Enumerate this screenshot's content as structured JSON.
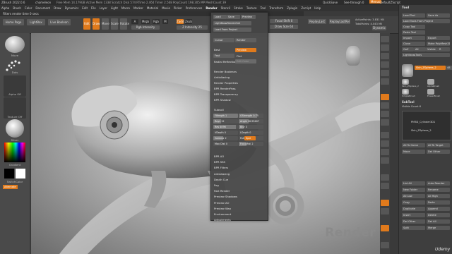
{
  "titlebar": {
    "app": "ZBrush 2022.0.6",
    "file": "chameleon",
    "stats": "Free Mem 14.179GB  Active Mem 1338  Scratch Disk 574  RTime 2.464  Timer 2.568  PolyCount 198.305 MP  MeshCount 39",
    "right": [
      "QuickSave",
      "See-through 0",
      "Menus",
      "DefaultZScript"
    ]
  },
  "menubar": [
    "Alpha",
    "Brush",
    "Color",
    "Document",
    "Draw",
    "Dynamics",
    "Edit",
    "File",
    "Layer",
    "Light",
    "Macro",
    "Marker",
    "Material",
    "Movie",
    "Picker",
    "Preferences",
    "Render",
    "Stencil",
    "Stroke",
    "Texture",
    "Tool",
    "Transform",
    "Zplugin",
    "Zscript",
    "Help"
  ],
  "notice": "Filters render time 0 secs",
  "toolbar": {
    "home": "Home Page",
    "lightbox": "LightBox",
    "livebool": "Live Boolean",
    "edit": "Edit",
    "draw": "Draw",
    "move": "Move",
    "scale": "Scale",
    "rotate": "Rotate",
    "a": "A",
    "mrgb": "Mrgb",
    "rgb": "Rgb",
    "m": "M",
    "zadd": "Zadd",
    "zsub": "Zsub",
    "rgb_intensity": "Rgb Intensity",
    "focal_shift": "Focal Shift 0",
    "draw_size": "Draw Size 64",
    "z_intensity": "Z Intensity 25",
    "replay_last": "ReplayLast",
    "replay_last_rel": "ReplayLastRel",
    "active_points": "ActivePoints: 3.831 Mil",
    "total_points": "TotalPoints: 4.043 Mil",
    "dynamic": "Dynamic"
  },
  "leftpanel": {
    "brush": "Move",
    "stroke": "Dots",
    "alpha": "Alpha Off",
    "texture": "Texture Off",
    "material": "Silver",
    "gradient": "Gradient",
    "switch_color": "SwitchColor",
    "alternate": "Alternate"
  },
  "rendermenu": {
    "load": "Load",
    "save": "Save",
    "preview": "Preview",
    "lightbox_render": "LightBox▸RenderSet",
    "load_from_project": "Load From Project",
    "cursor": "Cursor",
    "render_btn": "Render",
    "best": "Best",
    "preview_mode": "Preview",
    "fast": "Fast",
    "flat": "Flat",
    "radial": "Radial Reflection",
    "edit_color": "Edit Color",
    "items": [
      "Render Booleans",
      "Antialiasing",
      "Render Properties",
      "BPR RenderPass",
      "BPR Transparency",
      "BPR Shadow"
    ],
    "subsection": "Subsoil",
    "sliders": [
      {
        "label": "Filtregth 1",
        "v": 1
      },
      {
        "label": "GStrength 0.75",
        "v": 0.75
      },
      {
        "label": "Rays 12",
        "v": 0.3
      },
      {
        "label": "Angle 26.99467",
        "v": 0.4
      },
      {
        "label": "Res 4096",
        "v": 0.9
      },
      {
        "label": "Blur 3",
        "v": 0.2
      },
      {
        "label": "VDepth 0",
        "v": 0
      },
      {
        "label": "LDepth 0",
        "v": 0
      },
      {
        "label": "Gamma 2",
        "v": 0.4
      },
      {
        "label": "Falloff 0",
        "v": 0
      },
      {
        "label": "Max Dist 0",
        "v": 0
      },
      {
        "label": "FocusFall 2",
        "v": 0.3
      }
    ],
    "spd": "Spd",
    "items2": [
      "BPR AO",
      "BPR SSS",
      "BPR Filters",
      "Antialiasing",
      "Depth Cue",
      "Fog",
      "Fast Render",
      "Preview Shadows",
      "Preview AO",
      "Preview Wax",
      "Environment",
      "Adjustments"
    ]
  },
  "toolpanel": {
    "title": "Tool",
    "buttons": [
      "Load Tool",
      "Save As",
      "Load Tools From Project",
      "Copy Tool",
      "Paste Tool",
      "Import",
      "Export",
      "Clone",
      "Make PolyMesh3D",
      "GoZ",
      "All",
      "Visible",
      "R",
      "Lightbox▸Tools"
    ],
    "current": "Skin_ZSphere_2",
    "current_val": "48",
    "subtools_title": "SubTool",
    "visible_count": "Visible Count 6",
    "subtool_items": [
      "PM3D_Cylinder3D1",
      "Skin_ZSphere_2"
    ],
    "thumbs": [
      "Skin_ZSphere_2",
      "AlphaBrush",
      "SimpleBrush",
      "EraserBrush"
    ],
    "list_buttons": [
      "List All",
      "Auto Reorder",
      "New Folder",
      "Rename",
      "All Low",
      "All High",
      "Copy",
      "Paste",
      "Duplicate",
      "Append",
      "Insert",
      "Delete",
      "Del Other",
      "Del All",
      "Split",
      "Merge"
    ],
    "arrows": [
      "All To Home",
      "All To Target",
      "Move",
      "Del Other"
    ]
  },
  "viewport_label": "Render",
  "watermark": "Udemy",
  "colors": {
    "accent": "#e07a1c",
    "panel": "#3e3e3e",
    "menu_bg": "#464646"
  }
}
